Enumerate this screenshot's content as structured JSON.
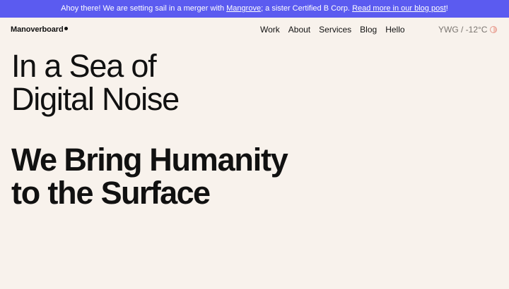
{
  "announcement": {
    "prefix": "Ahoy there! We are setting sail in a merger with ",
    "link1": "Mangrove",
    "middle": "; a sister Certified B Corp. ",
    "link2": "Read more in our blog post",
    "suffix": "!"
  },
  "header": {
    "logo": "Manoverboard",
    "nav": [
      "Work",
      "About",
      "Services",
      "Blog",
      "Hello"
    ],
    "weather": "YWG / -12°C",
    "theme_toggle_icon": "half-circle-icon"
  },
  "hero": {
    "line1": "In a Sea of",
    "line2": "Digital Noise",
    "line3_bold": "We Bring",
    "line3_rest": " Humanity",
    "line4_light": "to the ",
    "line4_bold": "Surface"
  },
  "colors": {
    "banner": "#5b5bf0",
    "background": "#f8f2ec",
    "text": "#111111",
    "muted": "#7a7570",
    "accent": "#e59a8e"
  }
}
